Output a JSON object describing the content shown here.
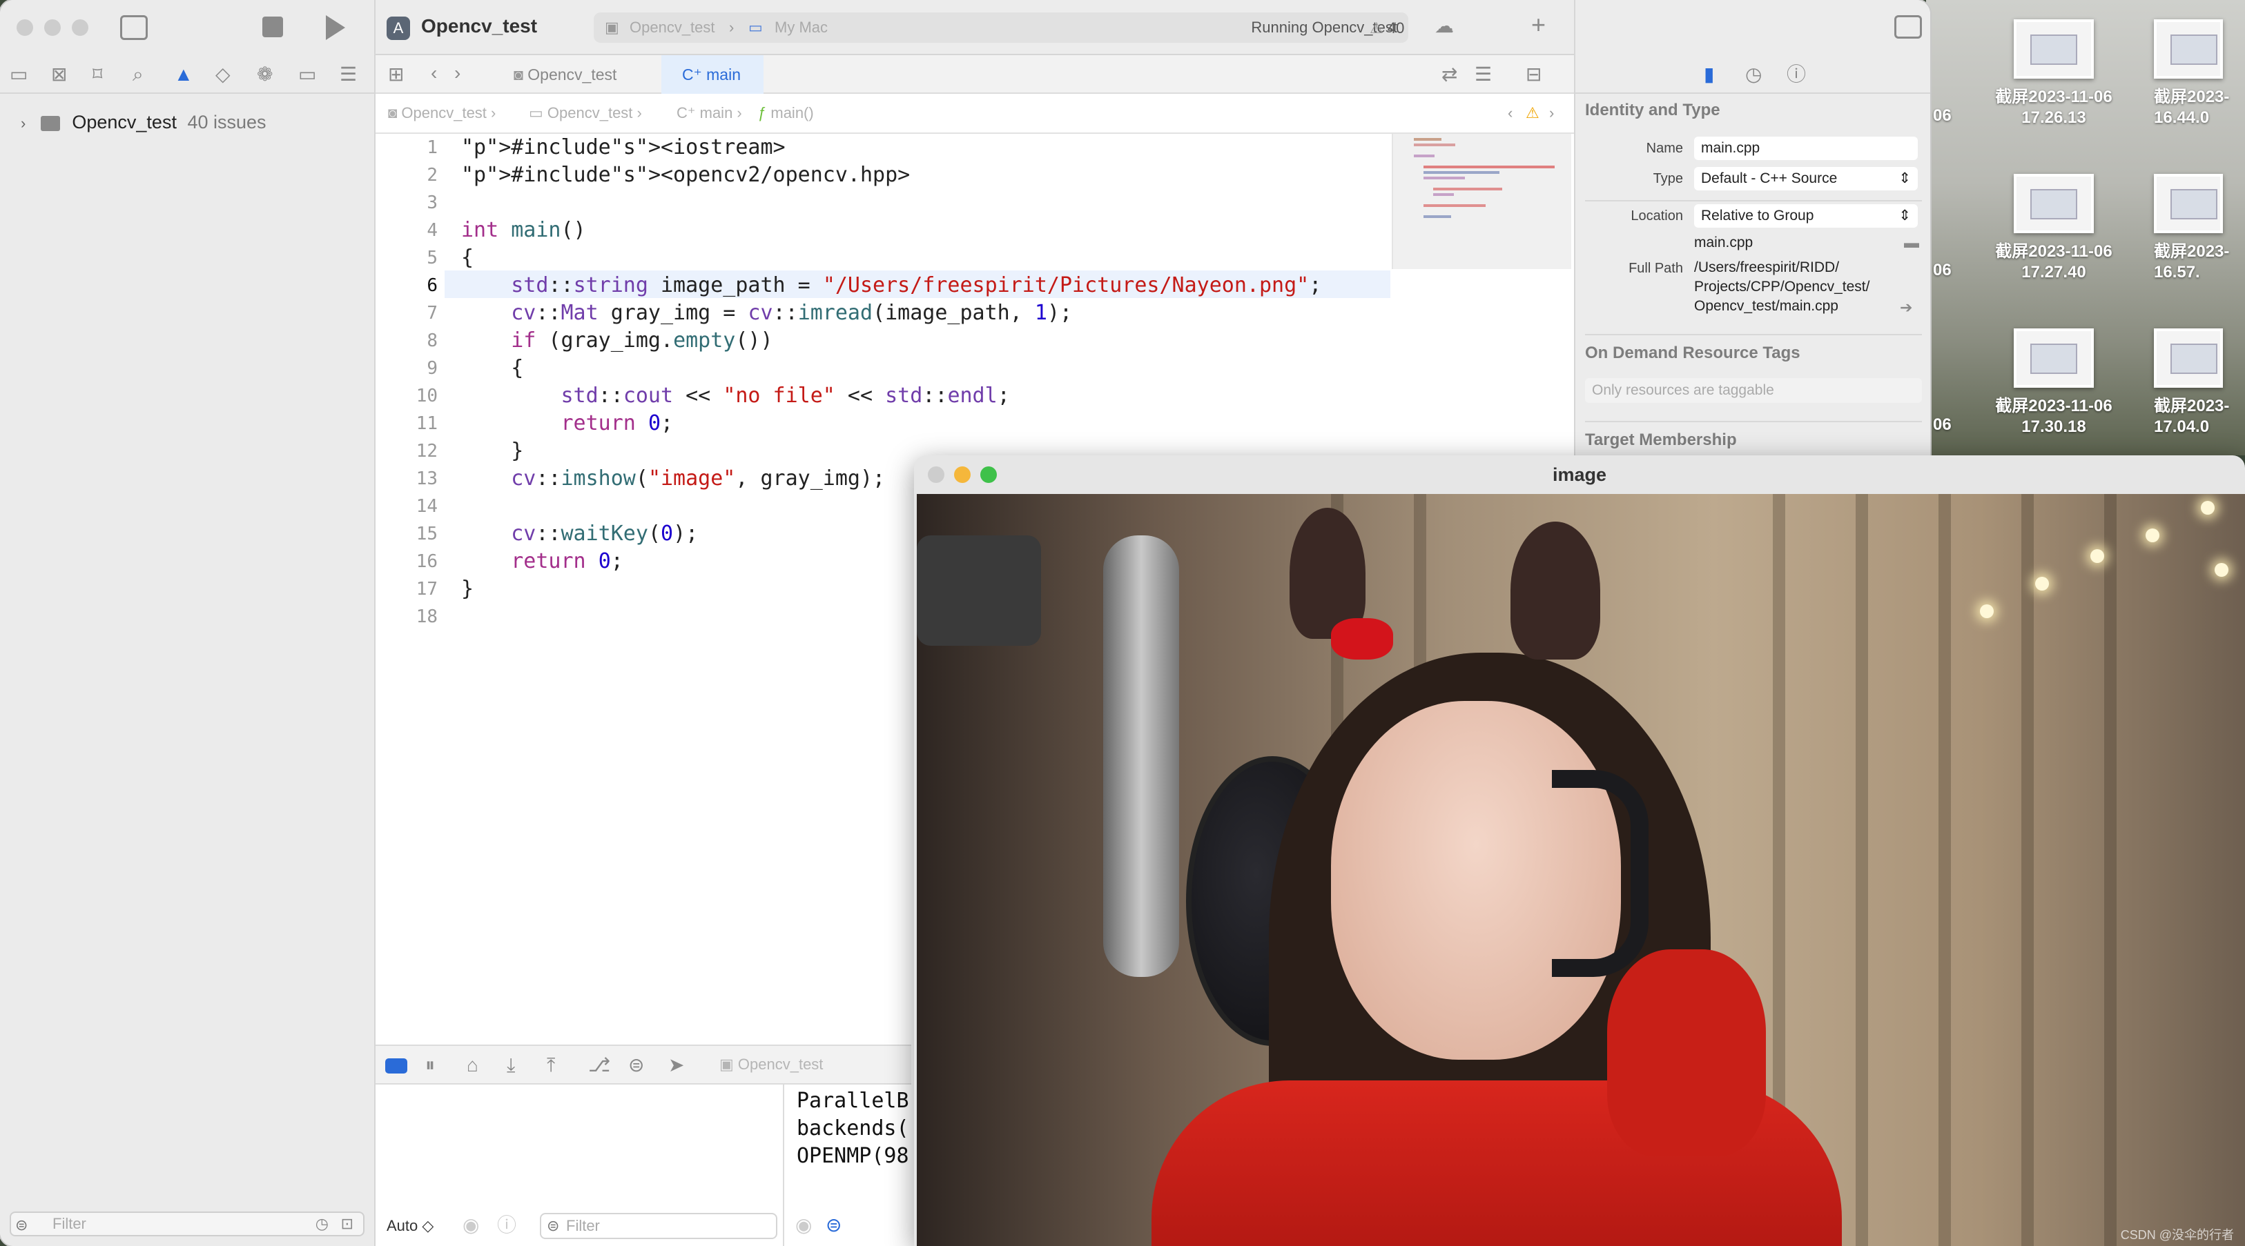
{
  "desktop": {
    "items": [
      {
        "line1": "截屏2023-11-06",
        "line2": "17.26.13"
      },
      {
        "line1": "截屏2023-11-06",
        "line2": "17.27.40"
      },
      {
        "line1": "截屏2023-11-06",
        "line2": "17.30.18"
      }
    ],
    "partial_right": [
      {
        "line1": "截屏2023-",
        "line2": "16.44.0"
      },
      {
        "line1": "截屏2023-",
        "line2": "16.57."
      },
      {
        "line1": "截屏2023-",
        "line2": "17.04.0"
      }
    ],
    "partial_left": [
      "06",
      "06",
      "06"
    ]
  },
  "xcode": {
    "project_title": "Opencv_test",
    "scheme": {
      "target": "Opencv_test",
      "destination": "My Mac",
      "status": "Running Opencv_test",
      "warnings": "40"
    },
    "navigator": {
      "project_name": "Opencv_test",
      "issues": "40 issues",
      "filter_placeholder": "Filter"
    },
    "tabs": [
      {
        "label": "Opencv_test"
      },
      {
        "label": "main"
      }
    ],
    "breadcrumb": [
      "Opencv_test",
      "Opencv_test",
      "main",
      "main()"
    ],
    "code_lines": [
      "#include<iostream>",
      "#include<opencv2/opencv.hpp>",
      "",
      "int main()",
      "{",
      "    std::string image_path = \"/Users/freespirit/Pictures/Nayeon.png\";",
      "    cv::Mat gray_img = cv::imread(image_path, 1);",
      "    if (gray_img.empty())",
      "    {",
      "        std::cout << \"no file\" << std::endl;",
      "        return 0;",
      "    }",
      "    cv::imshow(\"image\", gray_img);",
      "",
      "    cv::waitKey(0);",
      "    return 0;",
      "}",
      ""
    ],
    "current_line": 6,
    "debug": {
      "process": "Opencv_test",
      "auto_label": "Auto ◇",
      "filter_placeholder": "Filter"
    },
    "console_lines": [
      "ParallelB",
      "backends(",
      "OPENMP(98"
    ]
  },
  "inspector": {
    "identity_title": "Identity and Type",
    "name_label": "Name",
    "name_value": "main.cpp",
    "type_label": "Type",
    "type_value": "Default - C++ Source",
    "location_label": "Location",
    "location_value": "Relative to Group",
    "location_file": "main.cpp",
    "fullpath_label": "Full Path",
    "fullpath_lines": [
      "/Users/freespirit/RIDD/",
      "Projects/CPP/Opencv_test/",
      "Opencv_test/main.cpp"
    ],
    "odr_title": "On Demand Resource Tags",
    "odr_placeholder": "Only resources are taggable",
    "membership_title": "Target Membership"
  },
  "image_window": {
    "title": "image",
    "watermark": "CSDN @没伞的行者"
  },
  "colors": {
    "keyword": "#a32f8b",
    "string": "#c41a16",
    "type": "#703daa",
    "function": "#326d74",
    "number": "#1c00cf",
    "preprocessor": "#643820",
    "current_line": "#ebf2fd"
  }
}
